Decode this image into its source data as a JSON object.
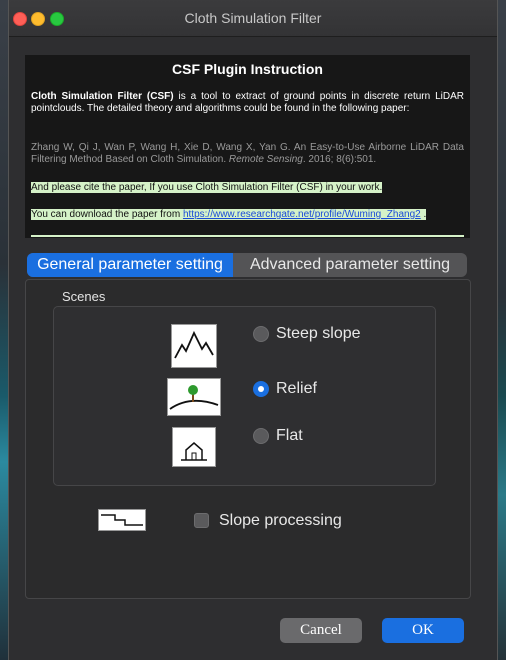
{
  "window": {
    "title": "Cloth Simulation Filter"
  },
  "instructions": {
    "title": "CSF Plugin Instruction",
    "intro_bold": "Cloth Simulation Filter (CSF)",
    "intro_rest": " is a tool to extract of ground points in discrete return LiDAR pointclouds. The detailed theory and algorithms could be found in the following paper:",
    "citation_authors": "Zhang W, Qi J, Wan P, Wang H, Xie D, Wang X, Yan G. An Easy-to-Use Airborne LiDAR Data Filtering Method Based on Cloth Simulation. ",
    "citation_journal": "Remote Sensing",
    "citation_rest": ". 2016; 8(6):501.",
    "cite_note": "And please cite the paper, If you use Cloth Simulation Filter (CSF) in your work.",
    "download_prefix": "You can download the paper from ",
    "download_link": "https://www.researchgate.net/profile/Wuming_Zhang2",
    "download_suffix": " ."
  },
  "tabs": [
    {
      "label": "General parameter setting",
      "active": true
    },
    {
      "label": "Advanced parameter setting",
      "active": false
    }
  ],
  "scenes": {
    "label": "Scenes",
    "options": [
      {
        "label": "Steep slope",
        "checked": false,
        "icon": "mountain-icon"
      },
      {
        "label": "Relief",
        "checked": true,
        "icon": "tree-hill-icon"
      },
      {
        "label": "Flat",
        "checked": false,
        "icon": "house-icon"
      }
    ]
  },
  "slope_processing": {
    "label": "Slope processing",
    "checked": false,
    "icon": "step-icon"
  },
  "buttons": {
    "cancel": "Cancel",
    "ok": "OK"
  },
  "colors": {
    "accent": "#1a6fe0",
    "highlight": "#d5f2c8",
    "window_bg": "#2e2e30"
  }
}
